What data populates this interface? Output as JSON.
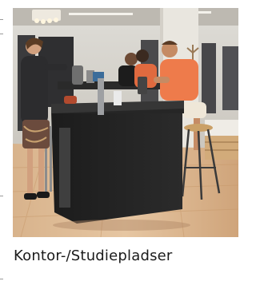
{
  "card": {
    "caption": "Kontor-/Studiepladser",
    "photo_alt": "Kontor-/Studiepladser"
  }
}
